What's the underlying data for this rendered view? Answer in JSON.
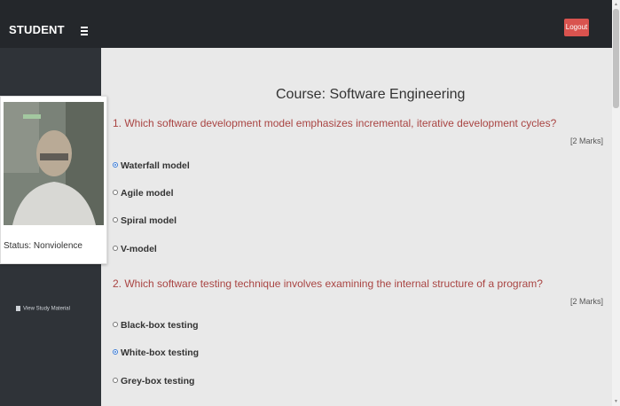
{
  "header": {
    "brand": "STUDENT",
    "logout_label": "Logout"
  },
  "sidebar": {
    "view_study_material": "View Study Material"
  },
  "exam": {
    "course": "Course: Software Engineering",
    "questions": [
      {
        "text": "1. Which software development model emphasizes incremental, iterative development cycles?",
        "marks": "[2 Marks]",
        "options": [
          {
            "label": "Waterfall model",
            "selected": true
          },
          {
            "label": "Agile model",
            "selected": false
          },
          {
            "label": "Spiral model",
            "selected": false
          },
          {
            "label": "V-model",
            "selected": false
          }
        ]
      },
      {
        "text": "2. Which software testing technique involves examining the internal structure of a program?",
        "marks": "[2 Marks]",
        "options": [
          {
            "label": "Black-box testing",
            "selected": false
          },
          {
            "label": "White-box testing",
            "selected": true
          },
          {
            "label": "Grey-box testing",
            "selected": false
          }
        ]
      }
    ]
  },
  "webcam": {
    "status": "Status: Nonviolence"
  },
  "colors": {
    "topbar": "#24272b",
    "sidebar": "#2f3338",
    "question": "#a94442",
    "logout": "#d9534f",
    "logo": "#3a8fd6"
  }
}
